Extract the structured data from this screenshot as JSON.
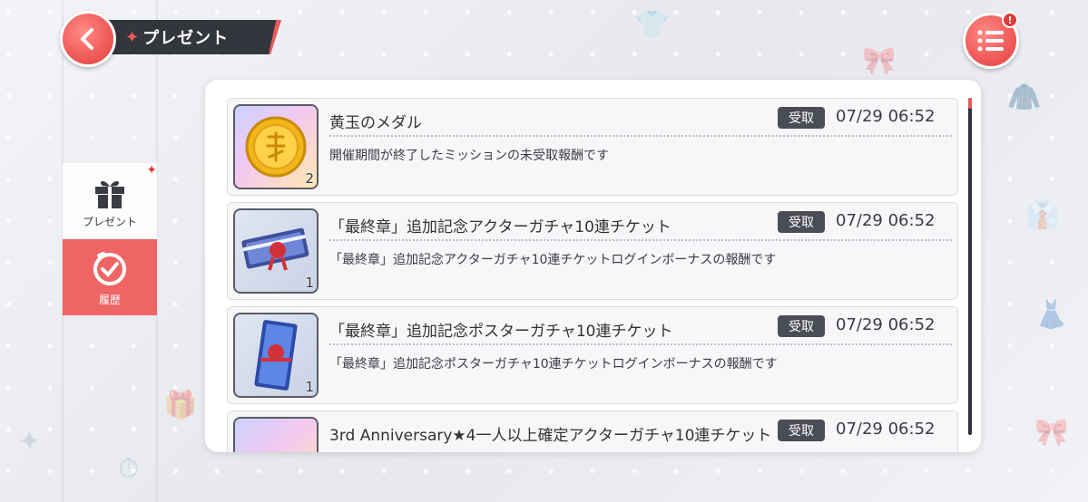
{
  "header": {
    "title": "プレゼント",
    "back_icon": "chevron-left-icon",
    "menu_icon": "list-menu-icon",
    "menu_alert": "!"
  },
  "side_tabs": [
    {
      "label": "プレゼント",
      "icon": "gift-icon",
      "active": false
    },
    {
      "label": "履歴",
      "icon": "clock-icon",
      "active": true
    }
  ],
  "gifts": [
    {
      "name": "黄玉のメダル",
      "status": "受取",
      "timestamp": "07/29 06:52",
      "description": "開催期間が終了したミッションの未受取報酬です",
      "quantity": "2",
      "thumbnail": "gold-medal"
    },
    {
      "name": "「最終章」追加記念アクターガチャ10連チケット",
      "status": "受取",
      "timestamp": "07/29 06:52",
      "description": "「最終章」追加記念アクターガチャ10連チケットログインボーナスの報酬です",
      "quantity": "1",
      "thumbnail": "actor-gacha-ticket"
    },
    {
      "name": "「最終章」追加記念ポスターガチャ10連チケット",
      "status": "受取",
      "timestamp": "07/29 06:52",
      "description": "「最終章」追加記念ポスターガチャ10連チケットログインボーナスの報酬です",
      "quantity": "1",
      "thumbnail": "poster-gacha-ticket"
    },
    {
      "name": "3rd Anniversary★4一人以上確定アクターガチャ10連チケット",
      "status": "受取",
      "timestamp": "07/29 06:52",
      "thumbnail": "anniversary-ticket"
    }
  ],
  "colors": {
    "accent": "#ef5a58",
    "dark": "#34363e",
    "badge": "#4a4c56"
  }
}
